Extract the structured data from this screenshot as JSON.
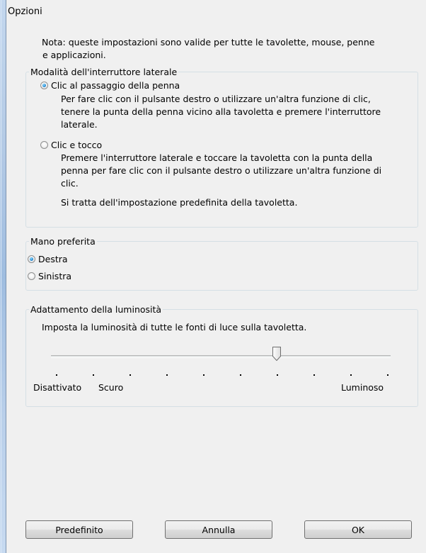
{
  "window": {
    "title": "Opzioni"
  },
  "note": {
    "line1": "Nota: queste impostazioni sono valide per tutte le tavolette, mouse, penne",
    "line2": "e applicazioni."
  },
  "side_switch": {
    "legend": "Modalità dell'interruttore laterale",
    "selected": "hover_click",
    "option_hover": {
      "label": "Clic al passaggio della penna",
      "desc": [
        "Per fare clic con il pulsante destro o utilizzare un'altra funzione di clic,",
        "tenere la punta della penna vicino alla tavoletta e premere l'interruttore",
        "laterale."
      ]
    },
    "option_touch": {
      "label": "Clic e tocco",
      "desc": [
        "Premere l'interruttore laterale e toccare la tavoletta con la punta della",
        "penna per fare clic con il pulsante destro o utilizzare un'altra funzione di",
        "clic."
      ],
      "default_note": "Si tratta dell'impostazione predefinita della tavoletta."
    }
  },
  "handedness": {
    "legend": "Mano preferita",
    "selected": "right",
    "right": "Destra",
    "left": "Sinistra"
  },
  "brightness": {
    "legend": "Adattamento della luminosità",
    "description": "Imposta la luminosità di tutte le fonti di luce sulla tavoletta.",
    "tick_count": 10,
    "value_index": 6,
    "label_off": "Disattivato",
    "label_dark": "Scuro",
    "label_bright": "Luminoso"
  },
  "buttons": {
    "default": "Predefinito",
    "cancel": "Annulla",
    "ok": "OK"
  }
}
